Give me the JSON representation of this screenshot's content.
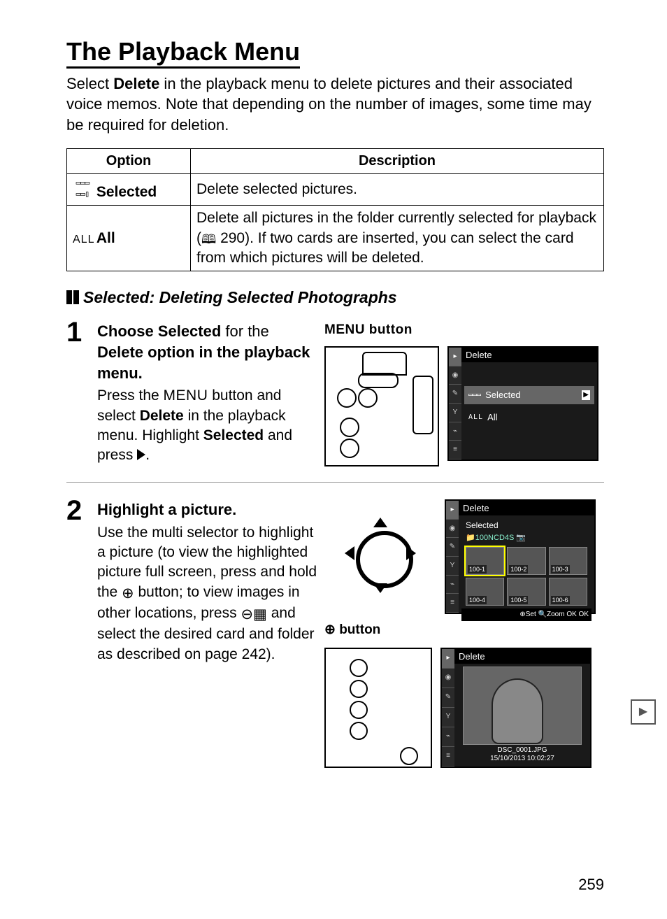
{
  "page_number": "259",
  "title": "The Playback Menu",
  "intro": {
    "pre": "Select ",
    "bold": "Delete",
    "post": " in the playback menu to delete pictures and their associated voice memos.  Note that depending on the number of images, some time may be required for deletion."
  },
  "table": {
    "headers": [
      "Option",
      "Description"
    ],
    "rows": [
      {
        "icon": "▯▯▯",
        "label": "Selected",
        "desc": "Delete selected pictures."
      },
      {
        "icon": "ALL",
        "label": "All",
        "desc_pre": "Delete all pictures in the folder currently selected for playback (",
        "desc_ref": "290",
        "desc_post": ").  If two cards are inserted, you can select the card from which pictures will be deleted."
      }
    ]
  },
  "subhead": "Selected: Deleting Selected Photographs",
  "step1": {
    "num": "1",
    "heading_pre": "Choose ",
    "heading_bold1": "Selected",
    "heading_mid": " for the ",
    "heading_bold2": "Delete",
    "heading_post": " option in the playback menu.",
    "body_pre": "Press the ",
    "body_menu": "MENU",
    "body_mid": " button and select ",
    "body_bold": "Delete",
    "body_mid2": " in the playback menu.  Highlight ",
    "body_bold2": "Selected",
    "body_post": " and press ",
    "fig_label": "MENU button",
    "lcd": {
      "title": "Delete",
      "rows": [
        {
          "icon": "▯▯▯",
          "label": "Selected",
          "selected": true
        },
        {
          "icon": "ALL",
          "label": "All",
          "selected": false
        }
      ]
    }
  },
  "step2": {
    "num": "2",
    "heading": "Highlight a picture.",
    "body_pre": "Use the multi selector to highlight a picture (to view the highlighted picture full screen, press and hold the ",
    "body_mid1": " button; to view images in other locations, press ",
    "body_mid2": " and select the desired card and folder as described on page 242).",
    "zoom_label": " button",
    "lcd_thumbs": {
      "title": "Delete",
      "subtitle": "Selected",
      "folder": "100NCD4S",
      "thumbs": [
        "100-1",
        "100-2",
        "100-3",
        "100-4",
        "100-5",
        "100-6"
      ],
      "bar": "⊕Set  🔍Zoom  OK OK"
    },
    "lcd_full": {
      "title": "Delete",
      "meta1": "DSC_0001.JPG",
      "meta2": "15/10/2013 10:02:27"
    }
  },
  "side_icon_label": "▶"
}
